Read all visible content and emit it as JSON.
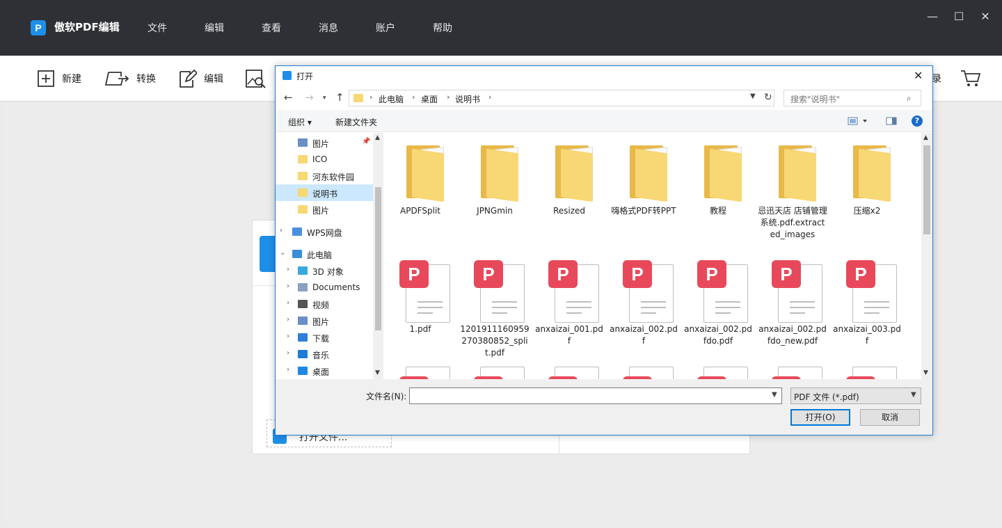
{
  "app": {
    "title": "傲软PDF编辑",
    "logo_letter": "P",
    "menu": [
      "文件",
      "编辑",
      "查看",
      "消息",
      "账户",
      "帮助"
    ],
    "window_controls": [
      "—",
      "☐",
      "✕"
    ]
  },
  "toolbar": {
    "new_label": "新建",
    "convert_label": "转换",
    "edit_label": "编辑",
    "login_fragment": "录"
  },
  "start": {
    "open_file_label": "打开文件..."
  },
  "dialog": {
    "title": "打开",
    "close_glyph": "✕",
    "breadcrumb": [
      "此电脑",
      "桌面",
      "说明书"
    ],
    "search_placeholder": "搜索\"说明书\"",
    "organize_label": "组织 ▾",
    "new_folder_label": "新建文件夹",
    "help_glyph": "?",
    "tree": [
      {
        "label": "图片",
        "icon": "picture-folder-icon",
        "color": "#6a8fc7",
        "selected": false,
        "pinned": true
      },
      {
        "label": "ICO",
        "icon": "folder-icon",
        "color": "#f8d775",
        "selected": false
      },
      {
        "label": "河东软件园",
        "icon": "folder-icon",
        "color": "#f8d775",
        "selected": false
      },
      {
        "label": "说明书",
        "icon": "folder-icon",
        "color": "#f8d775",
        "selected": true
      },
      {
        "label": "图片",
        "icon": "folder-icon",
        "color": "#f8d775",
        "selected": false
      },
      {
        "label": "WPS网盘",
        "icon": "cloud-icon",
        "color": "#4a90e2",
        "selected": false,
        "expandable": true
      },
      {
        "label": "此电脑",
        "icon": "computer-icon",
        "color": "#3a8ed8",
        "selected": false,
        "expanded": true
      },
      {
        "label": "3D 对象",
        "icon": "3d-objects-icon",
        "color": "#39a9dc",
        "selected": false,
        "expandable": true
      },
      {
        "label": "Documents",
        "icon": "documents-icon",
        "color": "#8aa2c0",
        "selected": false,
        "expandable": true
      },
      {
        "label": "视频",
        "icon": "video-icon",
        "color": "#555555",
        "selected": false,
        "expandable": true
      },
      {
        "label": "图片",
        "icon": "pictures-icon",
        "color": "#6a8fc7",
        "selected": false,
        "expandable": true
      },
      {
        "label": "下载",
        "icon": "download-icon",
        "color": "#2f7fd8",
        "selected": false,
        "expandable": true
      },
      {
        "label": "音乐",
        "icon": "music-icon",
        "color": "#1e7ad6",
        "selected": false,
        "expandable": true
      },
      {
        "label": "桌面",
        "icon": "desktop-icon",
        "color": "#1e88e5",
        "selected": false,
        "expandable": true
      }
    ],
    "files": [
      {
        "name": "APDFSplit",
        "type": "folder"
      },
      {
        "name": "JPNGmin",
        "type": "folder"
      },
      {
        "name": "Resized",
        "type": "folder"
      },
      {
        "name": "嗨格式PDF转PPT",
        "type": "folder"
      },
      {
        "name": "教程",
        "type": "folder"
      },
      {
        "name": "忌迅天店 店铺管理系统.pdf.extracted_images",
        "type": "folder"
      },
      {
        "name": "压缩x2",
        "type": "folder"
      },
      {
        "name": "1.pdf",
        "type": "pdf"
      },
      {
        "name": "1201911160959270380852_split.pdf",
        "type": "pdf"
      },
      {
        "name": "anxaizai_001.pdf",
        "type": "pdf"
      },
      {
        "name": "anxaizai_002.pdf",
        "type": "pdf"
      },
      {
        "name": "anxaizai_002.pdfdo.pdf",
        "type": "pdf"
      },
      {
        "name": "anxaizai_002.pdfdo_new.pdf",
        "type": "pdf"
      },
      {
        "name": "anxaizai_003.pdf",
        "type": "pdf"
      }
    ],
    "filename_label": "文件名(N):",
    "filename_value": "",
    "filter_value": "PDF 文件 (*.pdf)",
    "open_button": "打开(O)",
    "cancel_button": "取消",
    "pdf_badge_letter": "P"
  },
  "colors": {
    "accent": "#1e8fe8",
    "pdf_red": "#e8495a",
    "folder_yellow": "#f8d775",
    "titlebar_dark": "#2e3035",
    "selection": "#cce8ff"
  }
}
